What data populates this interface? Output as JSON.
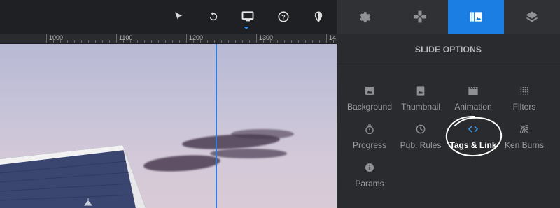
{
  "toolbar": {
    "buttons": [
      {
        "name": "cursor-icon"
      },
      {
        "name": "undo-icon"
      },
      {
        "name": "desktop-icon",
        "active": true
      },
      {
        "name": "help-icon"
      },
      {
        "name": "contrast-icon"
      }
    ]
  },
  "ruler": {
    "labels": [
      "1000",
      "1100",
      "1200",
      "1300",
      "14"
    ]
  },
  "tabs": [
    {
      "name": "gear-icon"
    },
    {
      "name": "gamepad-icon"
    },
    {
      "name": "slides-icon",
      "active": true
    },
    {
      "name": "layers-icon"
    }
  ],
  "panel": {
    "title": "SLIDE OPTIONS",
    "options": [
      {
        "label": "Background",
        "icon": "image-icon"
      },
      {
        "label": "Thumbnail",
        "icon": "portrait-icon"
      },
      {
        "label": "Animation",
        "icon": "clapper-icon"
      },
      {
        "label": "Filters",
        "icon": "grid-dots-icon"
      },
      {
        "label": "Progress",
        "icon": "stopwatch-icon"
      },
      {
        "label": "Pub. Rules",
        "icon": "clock-icon"
      },
      {
        "label": "Tags & Link",
        "icon": "code-icon",
        "active": true
      },
      {
        "label": "Ken Burns",
        "icon": "signal-icon"
      },
      {
        "label": "Params",
        "icon": "info-icon"
      }
    ]
  },
  "colors": {
    "accent": "#1a7ee3",
    "panel_bg": "#2a2b2e",
    "toolbar_bg": "#1f2023",
    "guide": "#2b7be0"
  }
}
